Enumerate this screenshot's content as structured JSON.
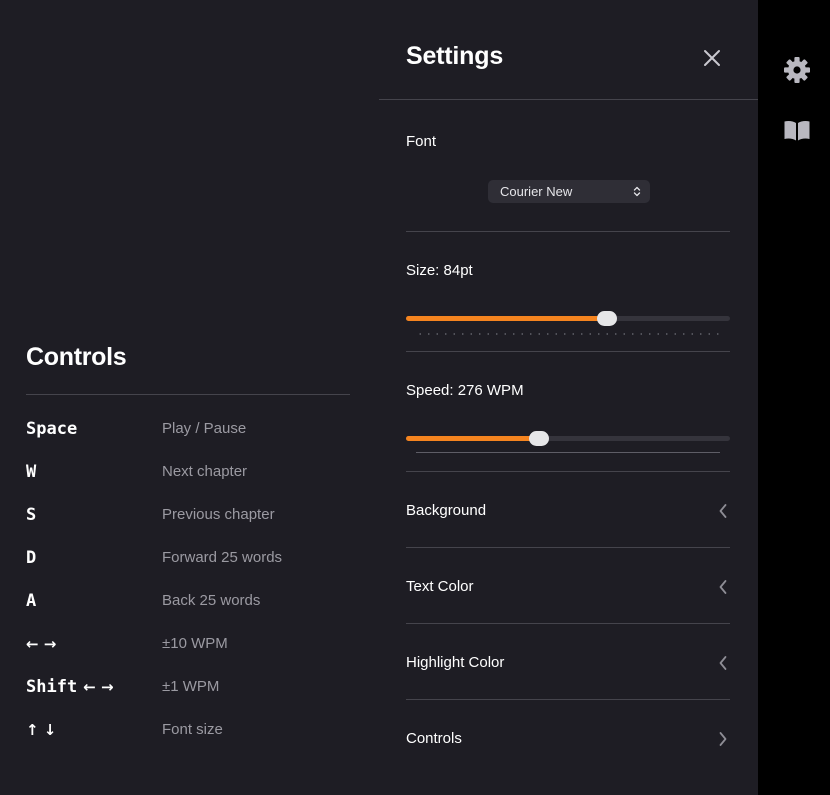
{
  "controls": {
    "title": "Controls",
    "rows": [
      {
        "key": "Space",
        "desc": "Play / Pause"
      },
      {
        "key": "W",
        "desc": "Next chapter"
      },
      {
        "key": "S",
        "desc": "Previous chapter"
      },
      {
        "key": "D",
        "desc": "Forward 25 words"
      },
      {
        "key": "A",
        "desc": "Back 25 words"
      },
      {
        "key": "",
        "arrows": "← →",
        "desc": "±10 WPM"
      },
      {
        "key": "Shift",
        "arrows": "← →",
        "desc": "±1 WPM"
      },
      {
        "key": "",
        "arrows": "↑ ↓",
        "desc": "Font size"
      }
    ]
  },
  "settings": {
    "title": "Settings",
    "close_icon": "close-icon",
    "font": {
      "label": "Font",
      "selected": "Courier New"
    },
    "size": {
      "label": "Size: 84pt",
      "value": 84,
      "fraction": 0.62
    },
    "speed": {
      "label": "Speed: 276 WPM",
      "value": 276,
      "fraction": 0.41
    },
    "nav": [
      {
        "label": "Background",
        "chevron": "chevron-left-icon"
      },
      {
        "label": "Text Color",
        "chevron": "chevron-left-icon"
      },
      {
        "label": "Highlight Color",
        "chevron": "chevron-left-icon"
      },
      {
        "label": "Controls",
        "chevron": "chevron-right-icon"
      }
    ]
  },
  "sidebar": {
    "icons": [
      "gear-icon",
      "book-icon"
    ]
  },
  "colors": {
    "accent": "#f5841f",
    "background": "#1e1d24",
    "sidebar": "#000000",
    "muted_text": "#9b9aa2"
  }
}
